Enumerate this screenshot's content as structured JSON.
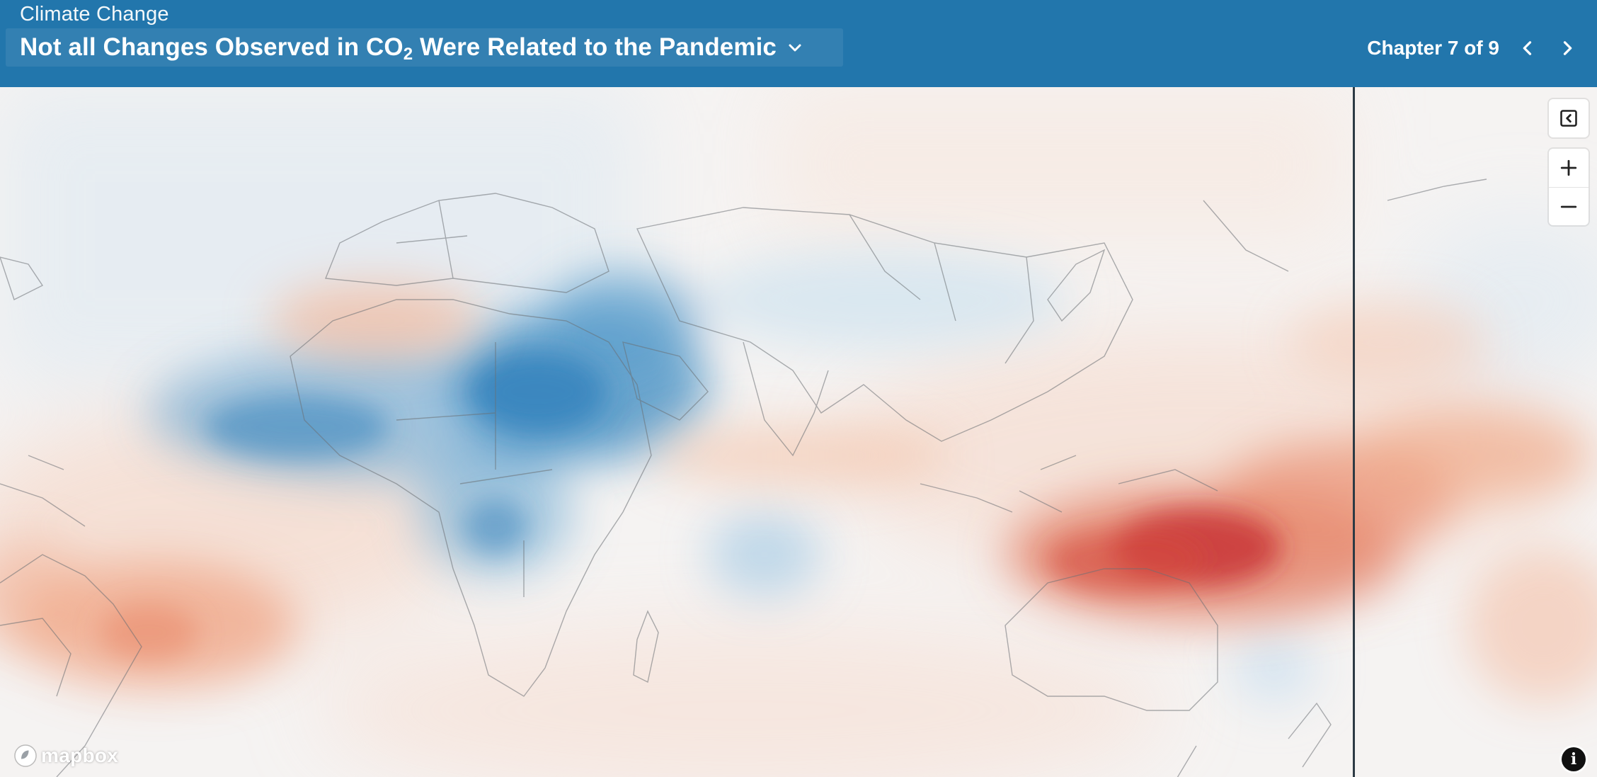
{
  "header": {
    "story_title": "Climate Change",
    "chapter_title_prefix": "Not all Changes Observed in CO",
    "chapter_title_subscript": "2",
    "chapter_title_suffix": " Were Related to the Pandemic",
    "chapter_counter": "Chapter 7 of 9"
  },
  "map": {
    "attribution_logo_text": "mapbox",
    "attribution_info_glyph": "i",
    "colors": {
      "header_bg": "#2276ac",
      "anomaly_positive": "#c4282e",
      "anomaly_negative": "#2f7fba",
      "neutral": "#f5f3f2",
      "divider": "#2c3a44"
    },
    "controls": {
      "panel_toggle_icon": "collapse-panel-icon",
      "zoom_in_icon": "plus-icon",
      "zoom_out_icon": "minus-icon"
    }
  }
}
